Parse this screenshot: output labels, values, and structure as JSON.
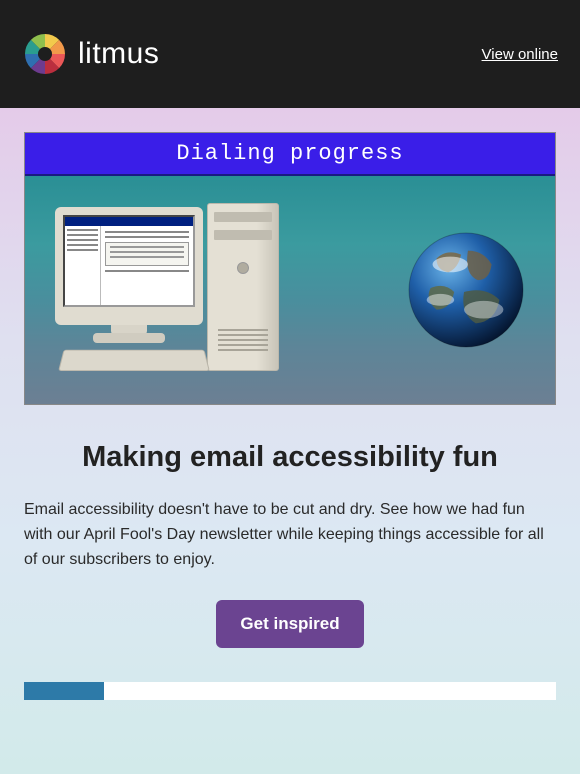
{
  "header": {
    "brand": "litmus",
    "view_online": "View online"
  },
  "hero": {
    "title": "Dialing progress"
  },
  "main": {
    "headline": "Making email accessibility fun",
    "body": "Email accessibility doesn't have to be cut and dry. See how we had fun with our April Fool's Day newsletter while keeping things accessible for all of our subscribers to enjoy.",
    "cta": "Get inspired"
  },
  "colors": {
    "header_bg": "#1e1e1e",
    "hero_title_bg": "#3a1ee8",
    "cta_bg": "#6b4491"
  }
}
